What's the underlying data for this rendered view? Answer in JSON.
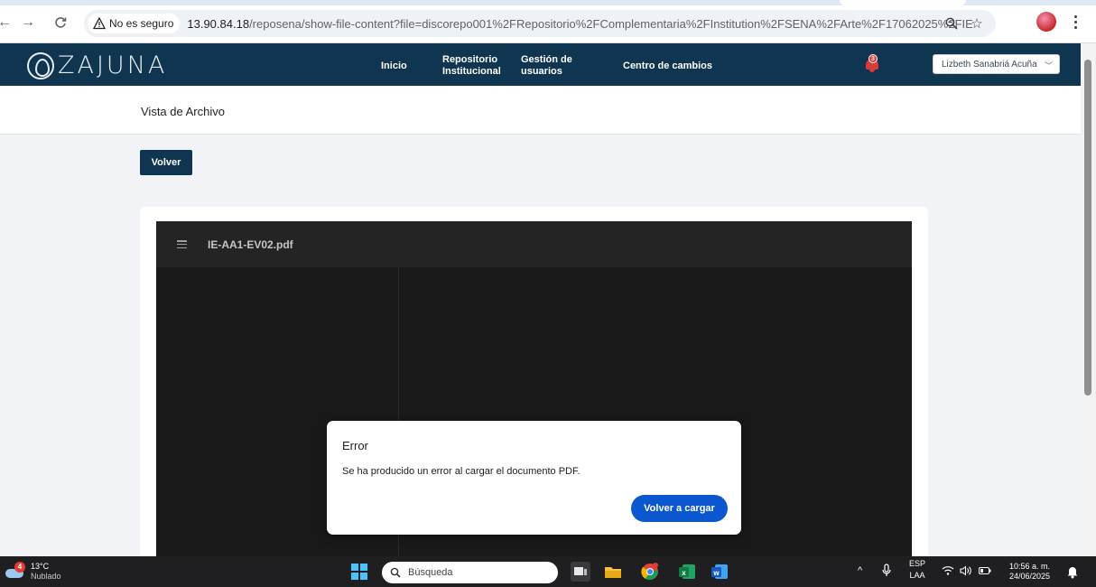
{
  "browser": {
    "security_label": "No es seguro",
    "url_host": "13.90.84.18",
    "url_path": "/reposena/show-file-content?file=discorepo001%2FRepositorio%2FComplementaria%2FInstitution%2FSENA%2FArte%2F17062025%2FIE-AA1-E..."
  },
  "header": {
    "logo_text": "ZAJUNA",
    "nav": [
      {
        "line1": "Inicio",
        "line2": ""
      },
      {
        "line1": "Repositorio",
        "line2": "Institucional"
      },
      {
        "line1": "Gestión de",
        "line2": "usuarios"
      },
      {
        "line1": "Centro de cambios",
        "line2": ""
      }
    ],
    "notification_count": "3",
    "user_name": "Lizbeth Sanabriá Acuña"
  },
  "page": {
    "title": "Vista de Archivo",
    "back_button": "Volver"
  },
  "viewer": {
    "file_name": "IE-AA1-EV02.pdf"
  },
  "dialog": {
    "title": "Error",
    "message": "Se ha producido un error al cargar el documento PDF.",
    "reload_button": "Volver a cargar"
  },
  "taskbar": {
    "weather_badge": "4",
    "temperature": "13°C",
    "condition": "Nublado",
    "search_placeholder": "Búsqueda",
    "language_line1": "ESP",
    "language_line2": "LAA",
    "time": "10:56 a. m.",
    "date": "24/06/2025"
  },
  "colors": {
    "brand_navy": "#0f3550",
    "accent_blue": "#0b57d0",
    "notification_red": "#d93b3b"
  },
  "icons": [
    "back-icon",
    "forward-icon",
    "reload-icon",
    "warning-icon",
    "zoom-icon",
    "star-icon",
    "extension-icon",
    "menu-dots-icon",
    "logo-icon",
    "bell-icon",
    "chevron-down-icon",
    "hamburger-icon",
    "weather-icon",
    "windows-icon",
    "search-icon",
    "mic-icon",
    "wifi-icon",
    "volume-icon",
    "battery-icon",
    "notification-icon"
  ]
}
